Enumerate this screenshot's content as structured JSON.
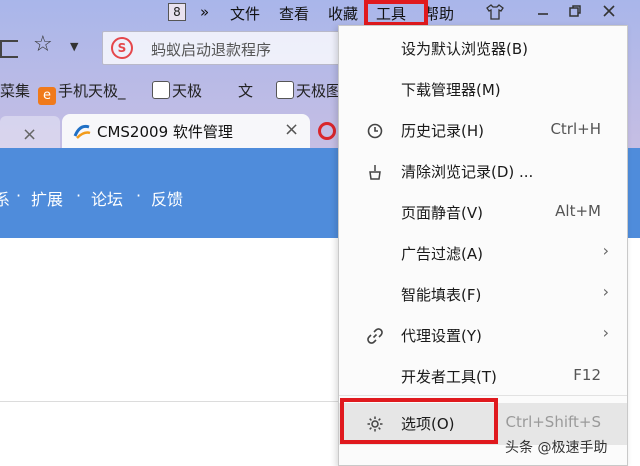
{
  "titlebar": {
    "badge": "8",
    "more": "»",
    "menus": [
      "文件",
      "查看",
      "收藏",
      "工具",
      "帮助"
    ],
    "skin_icon": "shirt-icon",
    "minimize_icon": "minimize-icon",
    "restore_icon": "restore-icon",
    "close_icon": "close-icon"
  },
  "address": {
    "logo_letter": "S",
    "text": "蚂蚁启动退款程序"
  },
  "bookmarks": [
    {
      "label": "菜集",
      "icon": "bookmark-icon"
    },
    {
      "label": "手机天极_",
      "icon": "site-e-icon"
    },
    {
      "label": "天极",
      "icon": "page-icon"
    },
    {
      "label": "文",
      "icon": "page-icon"
    },
    {
      "label": "天极图",
      "icon": "page-icon"
    }
  ],
  "tabs": {
    "active_title": "CMS2009 软件管理",
    "close": "×"
  },
  "nav": {
    "items": [
      "系",
      "扩展",
      "论坛",
      "反馈"
    ],
    "sep": "·"
  },
  "menu": {
    "items": [
      {
        "label": "设为默认浏览器(B)",
        "shortcut": "",
        "icon": "",
        "submenu": false
      },
      {
        "label": "下载管理器(M)",
        "shortcut": "",
        "icon": "",
        "submenu": false
      },
      {
        "label": "历史记录(H)",
        "shortcut": "Ctrl+H",
        "icon": "clock-icon",
        "submenu": false
      },
      {
        "label": "清除浏览记录(D) ...",
        "shortcut": "",
        "icon": "broom-icon",
        "submenu": false
      },
      {
        "label": "页面静音(V)",
        "shortcut": "Alt+M",
        "icon": "",
        "submenu": false
      },
      {
        "label": "广告过滤(A)",
        "shortcut": "",
        "icon": "",
        "submenu": true
      },
      {
        "label": "智能填表(F)",
        "shortcut": "",
        "icon": "",
        "submenu": true
      },
      {
        "label": "代理设置(Y)",
        "shortcut": "",
        "icon": "link-icon",
        "submenu": true
      },
      {
        "label": "开发者工具(T)",
        "shortcut": "F12",
        "icon": "",
        "submenu": false
      },
      {
        "label": "选项(O)",
        "shortcut": "Ctrl+Shift+S",
        "icon": "gear-icon",
        "submenu": false
      }
    ],
    "arrow": "›"
  },
  "watermark": "头条 @极速手助",
  "colors": {
    "highlight_red": "#e0191e",
    "nav_blue": "#4f8cdb"
  }
}
